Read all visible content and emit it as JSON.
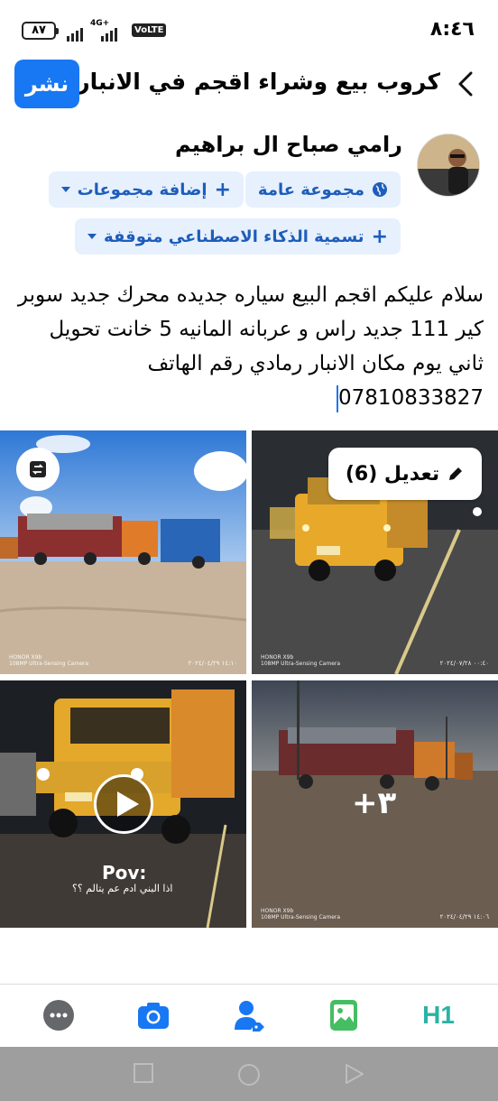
{
  "status": {
    "time": "٨:٤٦",
    "battery": "٨٧",
    "network": "4G+",
    "volte": "VoLTE"
  },
  "header": {
    "title": "كروب بيع وشراء اقجم في الانبار ...",
    "post_label": "نشر"
  },
  "author": {
    "name": "رامي صباح ال براهيم"
  },
  "chips": {
    "audience": "مجموعة عامة",
    "add_groups": "إضافة مجموعات",
    "ai_label": "تسمية الذكاء الاصطناعي متوقفة"
  },
  "post": {
    "text": "سلام عليكم اقجم البيع سياره جديده محرك جديد سوبر كير 111 جديد راس و عربانه المانيه 5 خانت تحويل ثاني يوم مكان الانبار رمادي رقم الهاتف 07810833827"
  },
  "media": {
    "edit_label": "تعديل (6)",
    "more_count": "+٣",
    "video_caption": "Pov:",
    "video_subcaption": "اذا البني ادم عم يتالم ؟؟",
    "watermark_brand": "HONOR X9b",
    "watermark_camera": "108MP Ultra-Sensing Camera",
    "timestamp_1": "١٤:١٠ ٢٠٢٤/٠٤/٢٩",
    "timestamp_2": "٠٠:٤٠ ٢٠٢٤/٠٧/٢٨",
    "timestamp_4": "١٤:٠٦ ٢٠٢٤/٠٤/٢٩"
  },
  "toolbar": {
    "h1_label": "H1"
  },
  "colors": {
    "accent": "#1877f2",
    "chip_bg": "#e7f0fd",
    "chip_text": "#1d5dbb",
    "green": "#45bd62",
    "teal": "#2bb3a3"
  }
}
